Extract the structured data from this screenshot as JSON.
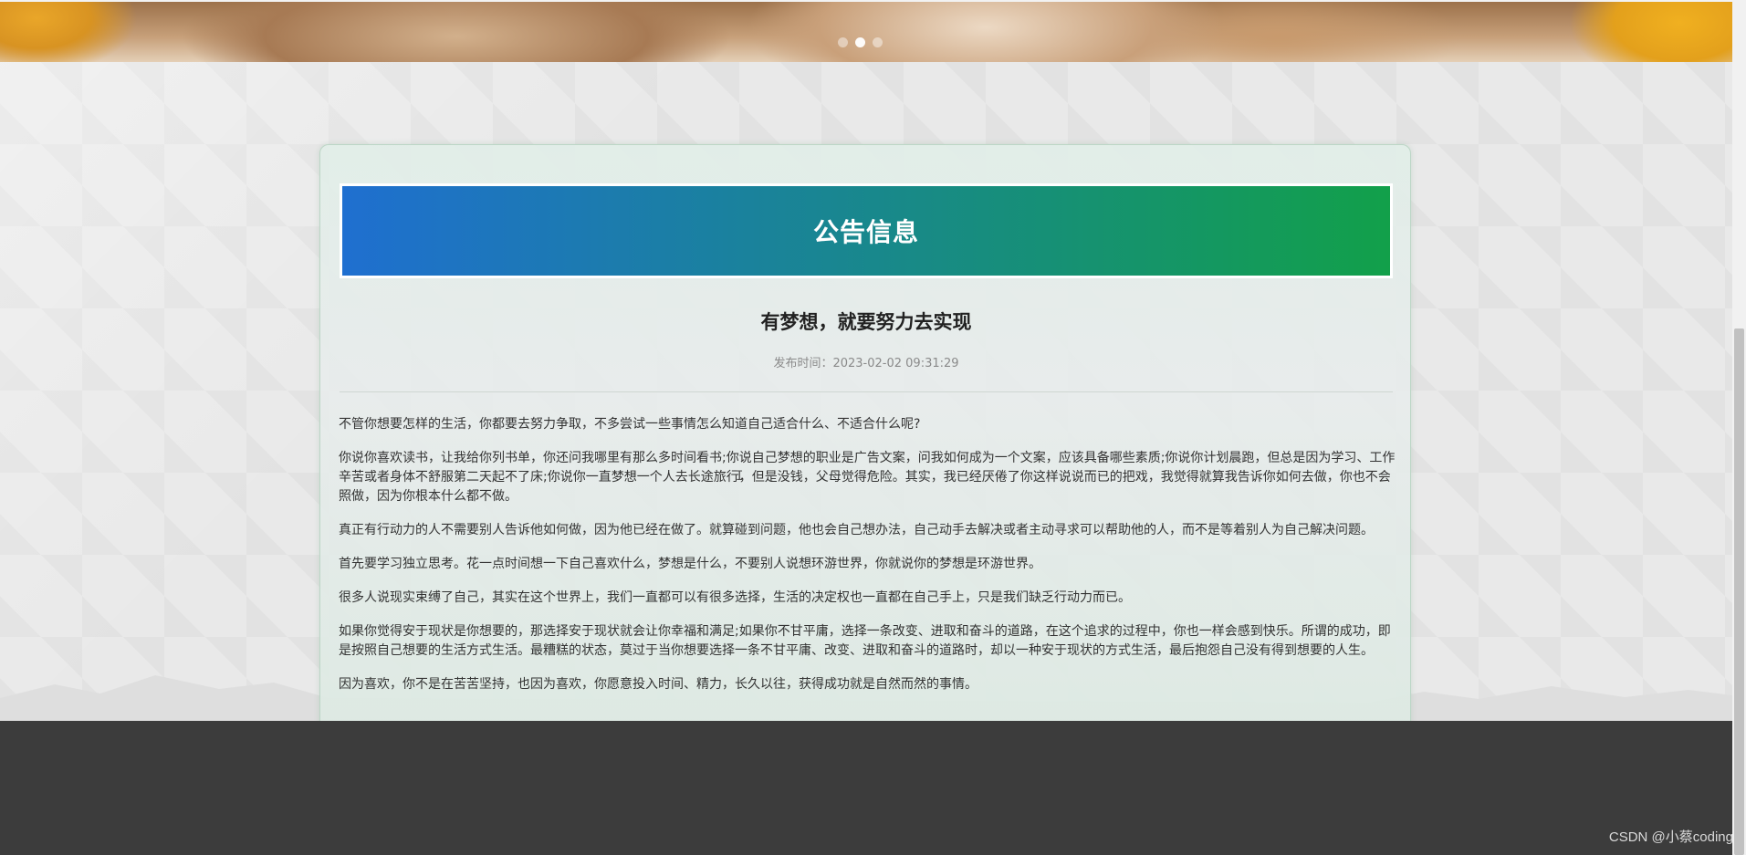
{
  "banner": {
    "carousel_dots": [
      {
        "active": false
      },
      {
        "active": true
      },
      {
        "active": false
      }
    ]
  },
  "notice": {
    "header_title": "公告信息",
    "article_title": "有梦想，就要努力去实现",
    "publish_label": "发布时间：",
    "publish_time": "2023-02-02 09:31:29",
    "paragraphs": [
      "不管你想要怎样的生活，你都要去努力争取，不多尝试一些事情怎么知道自己适合什么、不适合什么呢?",
      "你说你喜欢读书，让我给你列书单，你还问我哪里有那么多时间看书;你说自己梦想的职业是广告文案，问我如何成为一个文案，应该具备哪些素质;你说你计划晨跑，但总是因为学习、工作辛苦或者身体不舒服第二天起不了床;你说你一直梦想一个人去长途旅行，但是没钱，父母觉得危险。其实，我已经厌倦了你这样说说而已的把戏，我觉得就算我告诉你如何去做，你也不会照做，因为你根本什么都不做。",
      "真正有行动力的人不需要别人告诉他如何做，因为他已经在做了。就算碰到问题，他也会自己想办法，自己动手去解决或者主动寻求可以帮助他的人，而不是等着别人为自己解决问题。",
      "首先要学习独立思考。花一点时间想一下自己喜欢什么，梦想是什么，不要别人说想环游世界，你就说你的梦想是环游世界。",
      "很多人说现实束缚了自己，其实在这个世界上，我们一直都可以有很多选择，生活的决定权也一直都在自己手上，只是我们缺乏行动力而已。",
      "如果你觉得安于现状是你想要的，那选择安于现状就会让你幸福和满足;如果你不甘平庸，选择一条改变、进取和奋斗的道路，在这个追求的过程中，你也一样会感到快乐。所谓的成功，即是按照自己想要的生活方式生活。最糟糕的状态，莫过于当你想要选择一条不甘平庸、改变、进取和奋斗的道路时，却以一种安于现状的方式生活，最后抱怨自己没有得到想要的人生。",
      "因为喜欢，你不是在苦苦坚持，也因为喜欢，你愿意投入时间、精力，长久以往，获得成功就是自然而然的事情。"
    ]
  },
  "footer": {
    "watermark": "CSDN @小蔡coding"
  },
  "cursor_glyph": "I",
  "colors": {
    "header_gradient_start": "#1f6fd0",
    "header_gradient_end": "#12a04a",
    "footer_bg": "#3c3c3c",
    "card_border": "#bcd6c6"
  }
}
